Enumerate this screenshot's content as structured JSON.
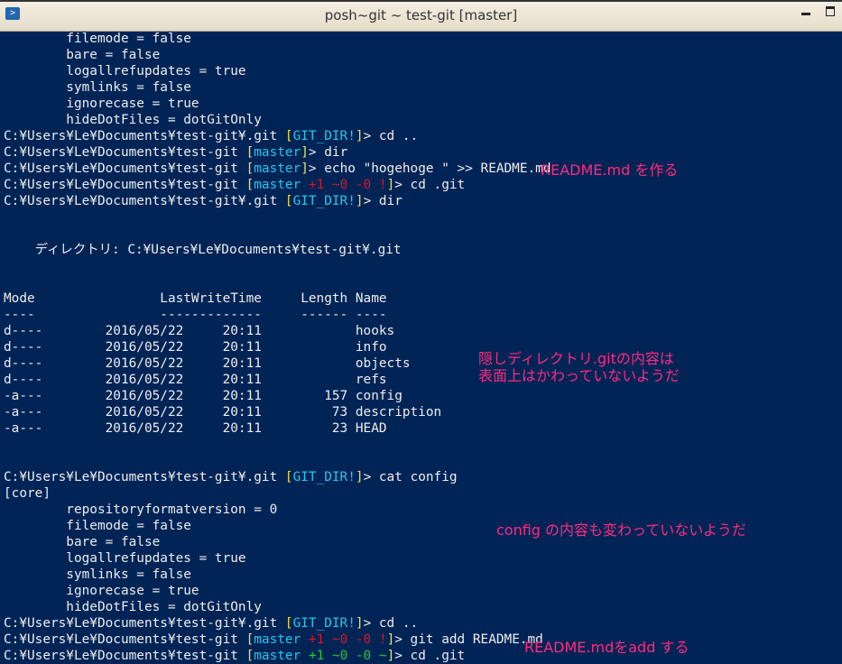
{
  "window": {
    "title": "posh~git ~ test-git [master]",
    "icon": "powershell-icon",
    "title_color": "#333333",
    "console_background": "#012456"
  },
  "console": {
    "lines": [
      {
        "segs": [
          {
            "t": "        filemode = false"
          }
        ]
      },
      {
        "segs": [
          {
            "t": "        bare = false"
          }
        ]
      },
      {
        "segs": [
          {
            "t": "        logallrefupdates = true"
          }
        ]
      },
      {
        "segs": [
          {
            "t": "        symlinks = false"
          }
        ]
      },
      {
        "segs": [
          {
            "t": "        ignorecase = true"
          }
        ]
      },
      {
        "segs": [
          {
            "t": "        hideDotFiles = dotGitOnly"
          }
        ]
      },
      {
        "segs": [
          {
            "t": "C:¥Users¥Le¥Documents¥test-git¥.git "
          },
          {
            "t": "[",
            "c": "y"
          },
          {
            "t": "GIT_DIR!",
            "c": "c"
          },
          {
            "t": "]",
            "c": "y"
          },
          {
            "t": "> cd .."
          }
        ]
      },
      {
        "segs": [
          {
            "t": "C:¥Users¥Le¥Documents¥test-git "
          },
          {
            "t": "[",
            "c": "y"
          },
          {
            "t": "master",
            "c": "c"
          },
          {
            "t": "]",
            "c": "y"
          },
          {
            "t": "> dir"
          }
        ]
      },
      {
        "segs": [
          {
            "t": "C:¥Users¥Le¥Documents¥test-git "
          },
          {
            "t": "[",
            "c": "y"
          },
          {
            "t": "master",
            "c": "c"
          },
          {
            "t": "]",
            "c": "y"
          },
          {
            "t": "> echo \"hogehoge \" >> README.md"
          }
        ]
      },
      {
        "segs": [
          {
            "t": "C:¥Users¥Le¥Documents¥test-git "
          },
          {
            "t": "[",
            "c": "y"
          },
          {
            "t": "master",
            "c": "c"
          },
          {
            "t": " +1 ~0 -0 !",
            "c": "r"
          },
          {
            "t": "]",
            "c": "y"
          },
          {
            "t": "> cd .git"
          }
        ]
      },
      {
        "segs": [
          {
            "t": "C:¥Users¥Le¥Documents¥test-git¥.git "
          },
          {
            "t": "[",
            "c": "y"
          },
          {
            "t": "GIT_DIR!",
            "c": "c"
          },
          {
            "t": "]",
            "c": "y"
          },
          {
            "t": "> dir"
          }
        ]
      },
      {
        "segs": [
          {
            "t": ""
          }
        ]
      },
      {
        "segs": [
          {
            "t": ""
          }
        ]
      },
      {
        "segs": [
          {
            "t": "    ディレクトリ: C:¥Users¥Le¥Documents¥test-git¥.git"
          }
        ]
      },
      {
        "segs": [
          {
            "t": ""
          }
        ]
      },
      {
        "segs": [
          {
            "t": ""
          }
        ]
      },
      {
        "segs": [
          {
            "t": "Mode                LastWriteTime     Length Name"
          }
        ]
      },
      {
        "segs": [
          {
            "t": "----                -------------     ------ ----"
          }
        ]
      },
      {
        "segs": [
          {
            "t": "d----        2016/05/22     20:11            hooks"
          }
        ]
      },
      {
        "segs": [
          {
            "t": "d----        2016/05/22     20:11            info"
          }
        ]
      },
      {
        "segs": [
          {
            "t": "d----        2016/05/22     20:11            objects"
          }
        ]
      },
      {
        "segs": [
          {
            "t": "d----        2016/05/22     20:11            refs"
          }
        ]
      },
      {
        "segs": [
          {
            "t": "-a---        2016/05/22     20:11        157 config"
          }
        ]
      },
      {
        "segs": [
          {
            "t": "-a---        2016/05/22     20:11         73 description"
          }
        ]
      },
      {
        "segs": [
          {
            "t": "-a---        2016/05/22     20:11         23 HEAD"
          }
        ]
      },
      {
        "segs": [
          {
            "t": ""
          }
        ]
      },
      {
        "segs": [
          {
            "t": ""
          }
        ]
      },
      {
        "segs": [
          {
            "t": "C:¥Users¥Le¥Documents¥test-git¥.git "
          },
          {
            "t": "[",
            "c": "y"
          },
          {
            "t": "GIT_DIR!",
            "c": "c"
          },
          {
            "t": "]",
            "c": "y"
          },
          {
            "t": "> cat config"
          }
        ]
      },
      {
        "segs": [
          {
            "t": "[core]"
          }
        ]
      },
      {
        "segs": [
          {
            "t": "        repositoryformatversion = 0"
          }
        ]
      },
      {
        "segs": [
          {
            "t": "        filemode = false"
          }
        ]
      },
      {
        "segs": [
          {
            "t": "        bare = false"
          }
        ]
      },
      {
        "segs": [
          {
            "t": "        logallrefupdates = true"
          }
        ]
      },
      {
        "segs": [
          {
            "t": "        symlinks = false"
          }
        ]
      },
      {
        "segs": [
          {
            "t": "        ignorecase = true"
          }
        ]
      },
      {
        "segs": [
          {
            "t": "        hideDotFiles = dotGitOnly"
          }
        ]
      },
      {
        "segs": [
          {
            "t": "C:¥Users¥Le¥Documents¥test-git¥.git "
          },
          {
            "t": "[",
            "c": "y"
          },
          {
            "t": "GIT_DIR!",
            "c": "c"
          },
          {
            "t": "]",
            "c": "y"
          },
          {
            "t": "> cd .."
          }
        ]
      },
      {
        "segs": [
          {
            "t": "C:¥Users¥Le¥Documents¥test-git "
          },
          {
            "t": "[",
            "c": "y"
          },
          {
            "t": "master",
            "c": "c"
          },
          {
            "t": " +1 ~0 -0 !",
            "c": "r"
          },
          {
            "t": "]",
            "c": "y"
          },
          {
            "t": "> git add README.md"
          }
        ]
      },
      {
        "segs": [
          {
            "t": "C:¥Users¥Le¥Documents¥test-git "
          },
          {
            "t": "[",
            "c": "y"
          },
          {
            "t": "master",
            "c": "c"
          },
          {
            "t": " +1 ~0 -0 ~",
            "c": "g"
          },
          {
            "t": "]",
            "c": "y"
          },
          {
            "t": "> cd .git"
          }
        ]
      }
    ]
  },
  "annotations": {
    "readme_create": "README.md を作る",
    "hidden_dir_line1": "隠しディレクトリ.gitの内容は",
    "hidden_dir_line2": "表面上はかわっていないようだ",
    "config_unchanged": "config の内容も変わっていないようだ",
    "readme_add": "README.mdをadd する"
  },
  "colors": {
    "text": "#eeeded",
    "prompt_bracket": "#f1e441",
    "branch": "#27c6ea",
    "status_untracked": "#e01722",
    "status_staged": "#22cd2f",
    "annotation": "#ff2b7e"
  }
}
